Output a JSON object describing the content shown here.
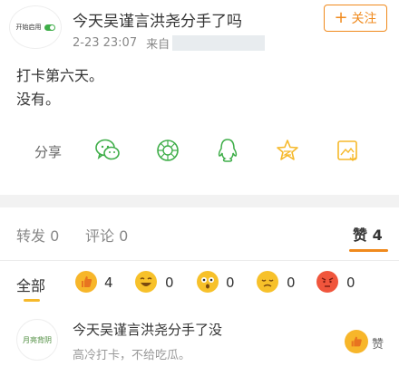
{
  "header": {
    "avatar_text": "开始启用",
    "username": "今天吴谨言洪尧分手了吗",
    "timestamp": "2-23 23:07",
    "from_label": "来自",
    "follow_label": "关注"
  },
  "post": {
    "lines": [
      "打卡第六天。",
      "没有。"
    ]
  },
  "share": {
    "label": "分享",
    "icons": [
      "wechat-icon",
      "moments-icon",
      "qq-icon",
      "qzone-icon",
      "save-image-icon"
    ]
  },
  "tabs": {
    "repost": "转发 0",
    "comment": "评论 0",
    "like": "赞 4"
  },
  "reactions": {
    "all_label": "全部",
    "items": [
      {
        "name": "thumbs-up-emoji",
        "count": "4"
      },
      {
        "name": "laugh-emoji",
        "count": "0"
      },
      {
        "name": "surprised-emoji",
        "count": "0"
      },
      {
        "name": "sad-emoji",
        "count": "0"
      },
      {
        "name": "angry-emoji",
        "count": "0"
      }
    ]
  },
  "comment": {
    "avatar_text": "月亮背阴",
    "name": "今天吴谨言洪尧分手了没",
    "text": "高冷打卡，不给吃瓜。",
    "like_label": "赞"
  },
  "colors": {
    "accent": "#f08a1d",
    "share_green": "#3fae49",
    "star_yellow": "#f6b92b"
  }
}
